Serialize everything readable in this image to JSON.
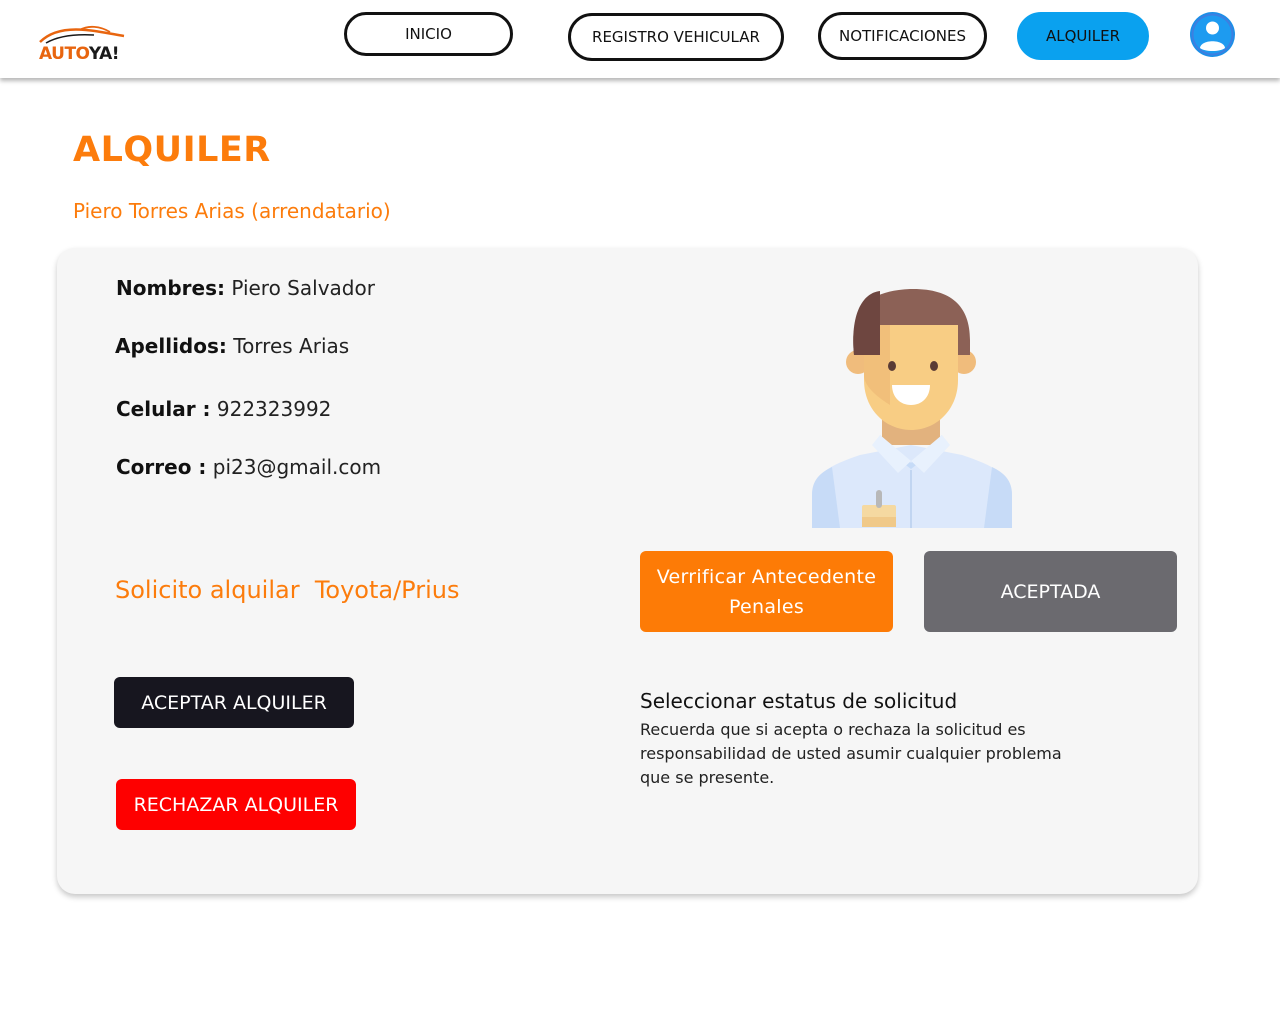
{
  "header": {
    "logo": {
      "part1": "AUTO",
      "part2": "YA!"
    },
    "nav": [
      {
        "label": "INICIO"
      },
      {
        "label": "REGISTRO VEHICULAR"
      },
      {
        "label": "NOTIFICACIONES"
      },
      {
        "label": "ALQUILER"
      }
    ],
    "avatar_icon": "user-avatar-icon"
  },
  "page": {
    "title": "ALQUILER",
    "subtitle": "Piero Torres Arias (arrendatario)"
  },
  "profile": {
    "fields": [
      {
        "label": "Nombres:",
        "value": " Piero Salvador"
      },
      {
        "label": "Apellidos:",
        "value": " Torres Arias"
      },
      {
        "label": "Celular :",
        "value": " 922323992"
      },
      {
        "label": "Correo :",
        "value": "  pi23@gmail.com"
      }
    ],
    "request_text": "Solicito alquilar  Toyota/Prius",
    "illustration_icon": "man-illustration-icon"
  },
  "actions": {
    "verify_label": "Verrificar Antecedente Penales",
    "status_label": "ACEPTADA",
    "accept_label": "ACEPTAR ALQUILER",
    "reject_label": "RECHAZAR ALQUILER"
  },
  "status_section": {
    "title": "Seleccionar estatus de solicitud",
    "note": "Recuerda que si acepta o rechaza la solicitud  es responsabilidad de usted asumir cualquier problema que se presente."
  },
  "colors": {
    "accent_orange": "#fc7c0c",
    "nav_active": "#0aa1ef",
    "status_grey": "#6b6a6f",
    "accept_dark": "#17161f",
    "reject_red": "#fe0000"
  }
}
